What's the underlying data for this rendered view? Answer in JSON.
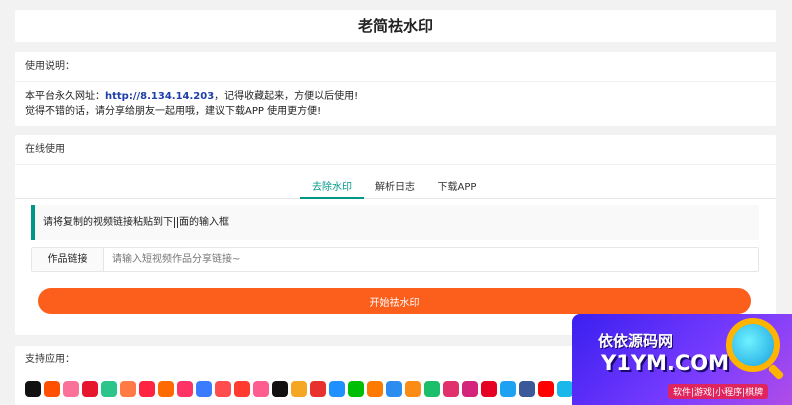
{
  "page": {
    "title": "老简祛水印"
  },
  "instructions": {
    "header": "使用说明：",
    "line1_prefix": "本平台永久网址：",
    "url": "http://8.134.14.203",
    "line1_suffix": "，记得收藏起来，方便以后使用!",
    "line2": "觉得不错的话，请分享给朋友一起用哦，建议下载APP 使用更方便!"
  },
  "online": {
    "header": "在线使用",
    "tabs": [
      {
        "label": "去除水印",
        "active": true
      },
      {
        "label": "解析日志",
        "active": false
      },
      {
        "label": "下载APP",
        "active": false
      }
    ],
    "tip_before": "请将复制的视频链接粘贴到下",
    "tip_after": "面的输入框",
    "input_label": "作品链接",
    "input_value": "",
    "input_placeholder": "请输入短视频作品分享链接~",
    "button_label": "开始祛水印",
    "colors": {
      "accent": "#009688",
      "button": "#fc5f1c"
    }
  },
  "support": {
    "header": "支持应用：",
    "apps": [
      {
        "icon": "douyin-icon",
        "color": "#111111"
      },
      {
        "icon": "kuaishou-icon",
        "color": "#ff5000"
      },
      {
        "icon": "bilibili-icon",
        "color": "#fb7299"
      },
      {
        "icon": "weibo-icon",
        "color": "#e6162d"
      },
      {
        "icon": "lvzhou-icon",
        "color": "#2bc48a"
      },
      {
        "icon": "pipixia-icon",
        "color": "#ff7a45"
      },
      {
        "icon": "xiaohongshu-icon",
        "color": "#ff2442"
      },
      {
        "icon": "huoshan-icon",
        "color": "#ff6a00"
      },
      {
        "icon": "weishi-icon",
        "color": "#ff3366"
      },
      {
        "icon": "zuiyou-icon",
        "color": "#3b7cff"
      },
      {
        "icon": "haokan-icon",
        "color": "#ff4d4f"
      },
      {
        "icon": "xigua-icon",
        "color": "#ff3b30"
      },
      {
        "icon": "meipai-icon",
        "color": "#ff5d8f"
      },
      {
        "icon": "capcut-icon",
        "color": "#111111"
      },
      {
        "icon": "momo-icon",
        "color": "#f5a623"
      },
      {
        "icon": "toutiao-icon",
        "color": "#e8312f"
      },
      {
        "icon": "youku-icon",
        "color": "#1e90ff"
      },
      {
        "icon": "aiqiyi-icon",
        "color": "#00be06"
      },
      {
        "icon": "kuaishou-lite-icon",
        "color": "#ff7a00"
      },
      {
        "icon": "tencent-video-icon",
        "color": "#2d8cf0"
      },
      {
        "icon": "kugou-icon",
        "color": "#fa8c16"
      },
      {
        "icon": "pearvideo-icon",
        "color": "#19be6b"
      },
      {
        "icon": "instagram-icon",
        "color": "#e1306c"
      },
      {
        "icon": "tiktok-icon",
        "color": "#d4237a"
      },
      {
        "icon": "pinterest-icon",
        "color": "#e60023"
      },
      {
        "icon": "twitter-icon",
        "color": "#1da1f2"
      },
      {
        "icon": "facebook-icon",
        "color": "#3b5998"
      },
      {
        "icon": "youtube-icon",
        "color": "#ff0000"
      },
      {
        "icon": "vimeo-icon",
        "color": "#1ab7ea"
      },
      {
        "icon": "likee-icon",
        "color": "#8a3ffc"
      },
      {
        "icon": "snack-icon",
        "color": "#ffc107"
      },
      {
        "icon": "douyin-lite-icon",
        "color": "#222222"
      }
    ]
  },
  "watermark": {
    "line1": "依依源码网",
    "line2": "Y1YM.COM",
    "line3": "软件|游戏|小程序|棋牌"
  }
}
